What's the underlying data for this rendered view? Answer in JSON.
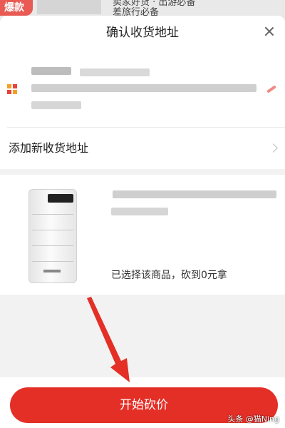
{
  "background": {
    "badge_text": "爆款",
    "title_top": "卖家好货 · 出游必备",
    "title": "差旅行必备"
  },
  "dialog": {
    "title": "确认收货地址",
    "close_icon": "close-icon"
  },
  "address": {
    "name": "",
    "phone": "",
    "detail": "",
    "pin_icon": "location-pin-icon",
    "edit_icon": "edit-pencil-icon"
  },
  "add_address": {
    "label": "添加新收货地址",
    "icon": "chevron-right-icon"
  },
  "product": {
    "title": "",
    "selected_note": "已选择该商品，砍到0元拿"
  },
  "action": {
    "start_label": "开始砍价"
  },
  "watermark": "头条 @猫Ning",
  "colors": {
    "brand": "#e42f27",
    "edit_icon": "#f08a85",
    "pin_icon": [
      "#f4a024",
      "#e8423a"
    ]
  }
}
